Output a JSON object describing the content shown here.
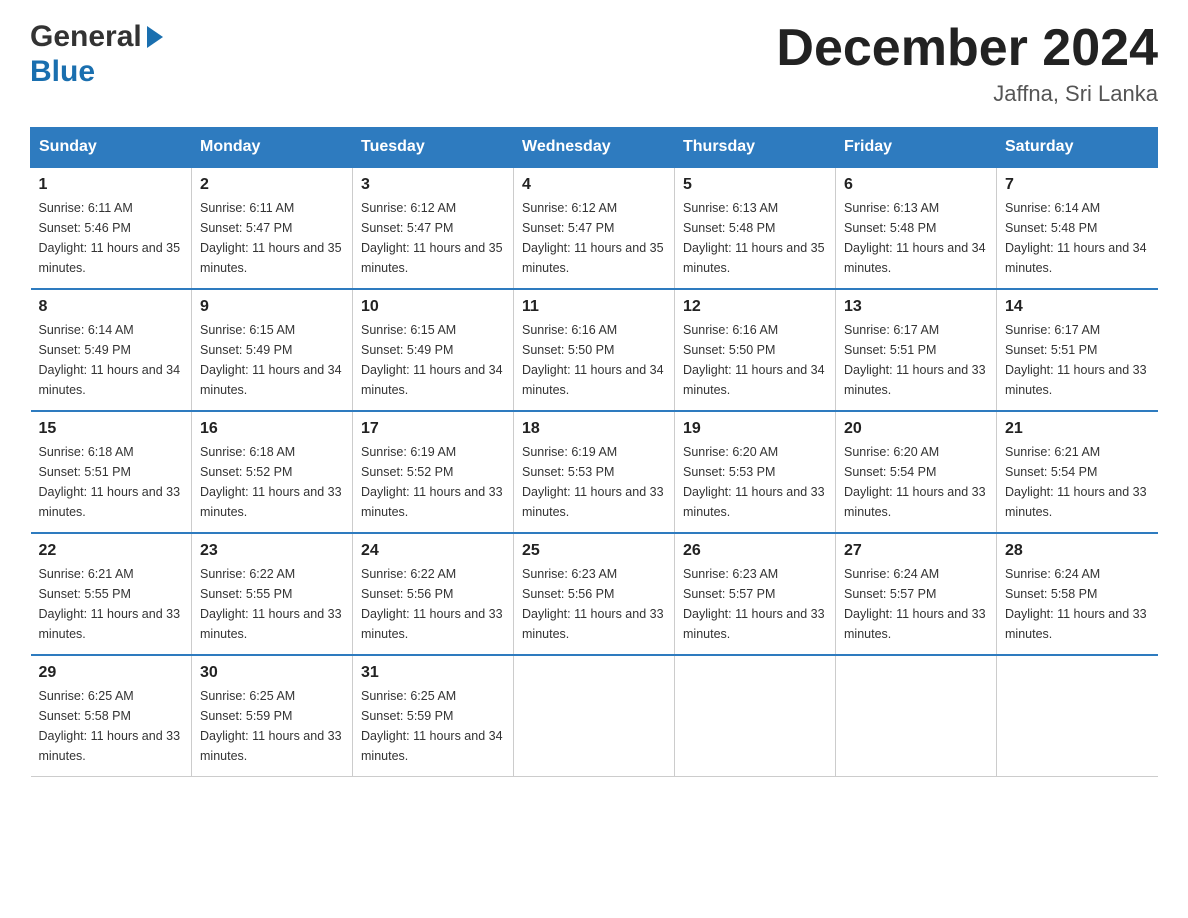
{
  "header": {
    "logo_general": "General",
    "logo_blue": "Blue",
    "month_year": "December 2024",
    "location": "Jaffna, Sri Lanka"
  },
  "days_of_week": [
    "Sunday",
    "Monday",
    "Tuesday",
    "Wednesday",
    "Thursday",
    "Friday",
    "Saturday"
  ],
  "weeks": [
    [
      {
        "day": "1",
        "sunrise": "6:11 AM",
        "sunset": "5:46 PM",
        "daylight": "11 hours and 35 minutes."
      },
      {
        "day": "2",
        "sunrise": "6:11 AM",
        "sunset": "5:47 PM",
        "daylight": "11 hours and 35 minutes."
      },
      {
        "day": "3",
        "sunrise": "6:12 AM",
        "sunset": "5:47 PM",
        "daylight": "11 hours and 35 minutes."
      },
      {
        "day": "4",
        "sunrise": "6:12 AM",
        "sunset": "5:47 PM",
        "daylight": "11 hours and 35 minutes."
      },
      {
        "day": "5",
        "sunrise": "6:13 AM",
        "sunset": "5:48 PM",
        "daylight": "11 hours and 35 minutes."
      },
      {
        "day": "6",
        "sunrise": "6:13 AM",
        "sunset": "5:48 PM",
        "daylight": "11 hours and 34 minutes."
      },
      {
        "day": "7",
        "sunrise": "6:14 AM",
        "sunset": "5:48 PM",
        "daylight": "11 hours and 34 minutes."
      }
    ],
    [
      {
        "day": "8",
        "sunrise": "6:14 AM",
        "sunset": "5:49 PM",
        "daylight": "11 hours and 34 minutes."
      },
      {
        "day": "9",
        "sunrise": "6:15 AM",
        "sunset": "5:49 PM",
        "daylight": "11 hours and 34 minutes."
      },
      {
        "day": "10",
        "sunrise": "6:15 AM",
        "sunset": "5:49 PM",
        "daylight": "11 hours and 34 minutes."
      },
      {
        "day": "11",
        "sunrise": "6:16 AM",
        "sunset": "5:50 PM",
        "daylight": "11 hours and 34 minutes."
      },
      {
        "day": "12",
        "sunrise": "6:16 AM",
        "sunset": "5:50 PM",
        "daylight": "11 hours and 34 minutes."
      },
      {
        "day": "13",
        "sunrise": "6:17 AM",
        "sunset": "5:51 PM",
        "daylight": "11 hours and 33 minutes."
      },
      {
        "day": "14",
        "sunrise": "6:17 AM",
        "sunset": "5:51 PM",
        "daylight": "11 hours and 33 minutes."
      }
    ],
    [
      {
        "day": "15",
        "sunrise": "6:18 AM",
        "sunset": "5:51 PM",
        "daylight": "11 hours and 33 minutes."
      },
      {
        "day": "16",
        "sunrise": "6:18 AM",
        "sunset": "5:52 PM",
        "daylight": "11 hours and 33 minutes."
      },
      {
        "day": "17",
        "sunrise": "6:19 AM",
        "sunset": "5:52 PM",
        "daylight": "11 hours and 33 minutes."
      },
      {
        "day": "18",
        "sunrise": "6:19 AM",
        "sunset": "5:53 PM",
        "daylight": "11 hours and 33 minutes."
      },
      {
        "day": "19",
        "sunrise": "6:20 AM",
        "sunset": "5:53 PM",
        "daylight": "11 hours and 33 minutes."
      },
      {
        "day": "20",
        "sunrise": "6:20 AM",
        "sunset": "5:54 PM",
        "daylight": "11 hours and 33 minutes."
      },
      {
        "day": "21",
        "sunrise": "6:21 AM",
        "sunset": "5:54 PM",
        "daylight": "11 hours and 33 minutes."
      }
    ],
    [
      {
        "day": "22",
        "sunrise": "6:21 AM",
        "sunset": "5:55 PM",
        "daylight": "11 hours and 33 minutes."
      },
      {
        "day": "23",
        "sunrise": "6:22 AM",
        "sunset": "5:55 PM",
        "daylight": "11 hours and 33 minutes."
      },
      {
        "day": "24",
        "sunrise": "6:22 AM",
        "sunset": "5:56 PM",
        "daylight": "11 hours and 33 minutes."
      },
      {
        "day": "25",
        "sunrise": "6:23 AM",
        "sunset": "5:56 PM",
        "daylight": "11 hours and 33 minutes."
      },
      {
        "day": "26",
        "sunrise": "6:23 AM",
        "sunset": "5:57 PM",
        "daylight": "11 hours and 33 minutes."
      },
      {
        "day": "27",
        "sunrise": "6:24 AM",
        "sunset": "5:57 PM",
        "daylight": "11 hours and 33 minutes."
      },
      {
        "day": "28",
        "sunrise": "6:24 AM",
        "sunset": "5:58 PM",
        "daylight": "11 hours and 33 minutes."
      }
    ],
    [
      {
        "day": "29",
        "sunrise": "6:25 AM",
        "sunset": "5:58 PM",
        "daylight": "11 hours and 33 minutes."
      },
      {
        "day": "30",
        "sunrise": "6:25 AM",
        "sunset": "5:59 PM",
        "daylight": "11 hours and 33 minutes."
      },
      {
        "day": "31",
        "sunrise": "6:25 AM",
        "sunset": "5:59 PM",
        "daylight": "11 hours and 34 minutes."
      },
      null,
      null,
      null,
      null
    ]
  ],
  "labels": {
    "sunrise_prefix": "Sunrise: ",
    "sunset_prefix": "Sunset: ",
    "daylight_prefix": "Daylight: "
  }
}
